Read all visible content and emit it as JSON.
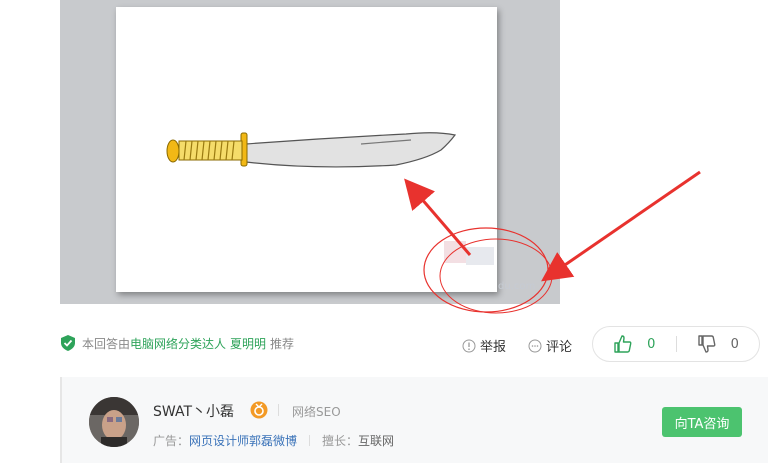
{
  "slide": {
    "watermark_text": "du.com"
  },
  "answer_meta": {
    "prefix": "本回答由",
    "category": "电脑网络分类达人",
    "author": "夏明明",
    "suffix": "推荐"
  },
  "actions": {
    "report_label": "举报",
    "comment_label": "评论"
  },
  "votes": {
    "up_count": "0",
    "down_count": "0"
  },
  "expert": {
    "name": "SWAT丶小磊",
    "field": "网络SEO",
    "ad_prefix": "广告：",
    "ad_link": "网页设计师郭磊微博",
    "specialty_label": "擅长：",
    "specialty_value": "互联网",
    "consult_label": "向TA咨询"
  },
  "colors": {
    "accent_green": "#4cc36f",
    "link_blue": "#3b73b9",
    "arrow_red": "#e8322e"
  }
}
